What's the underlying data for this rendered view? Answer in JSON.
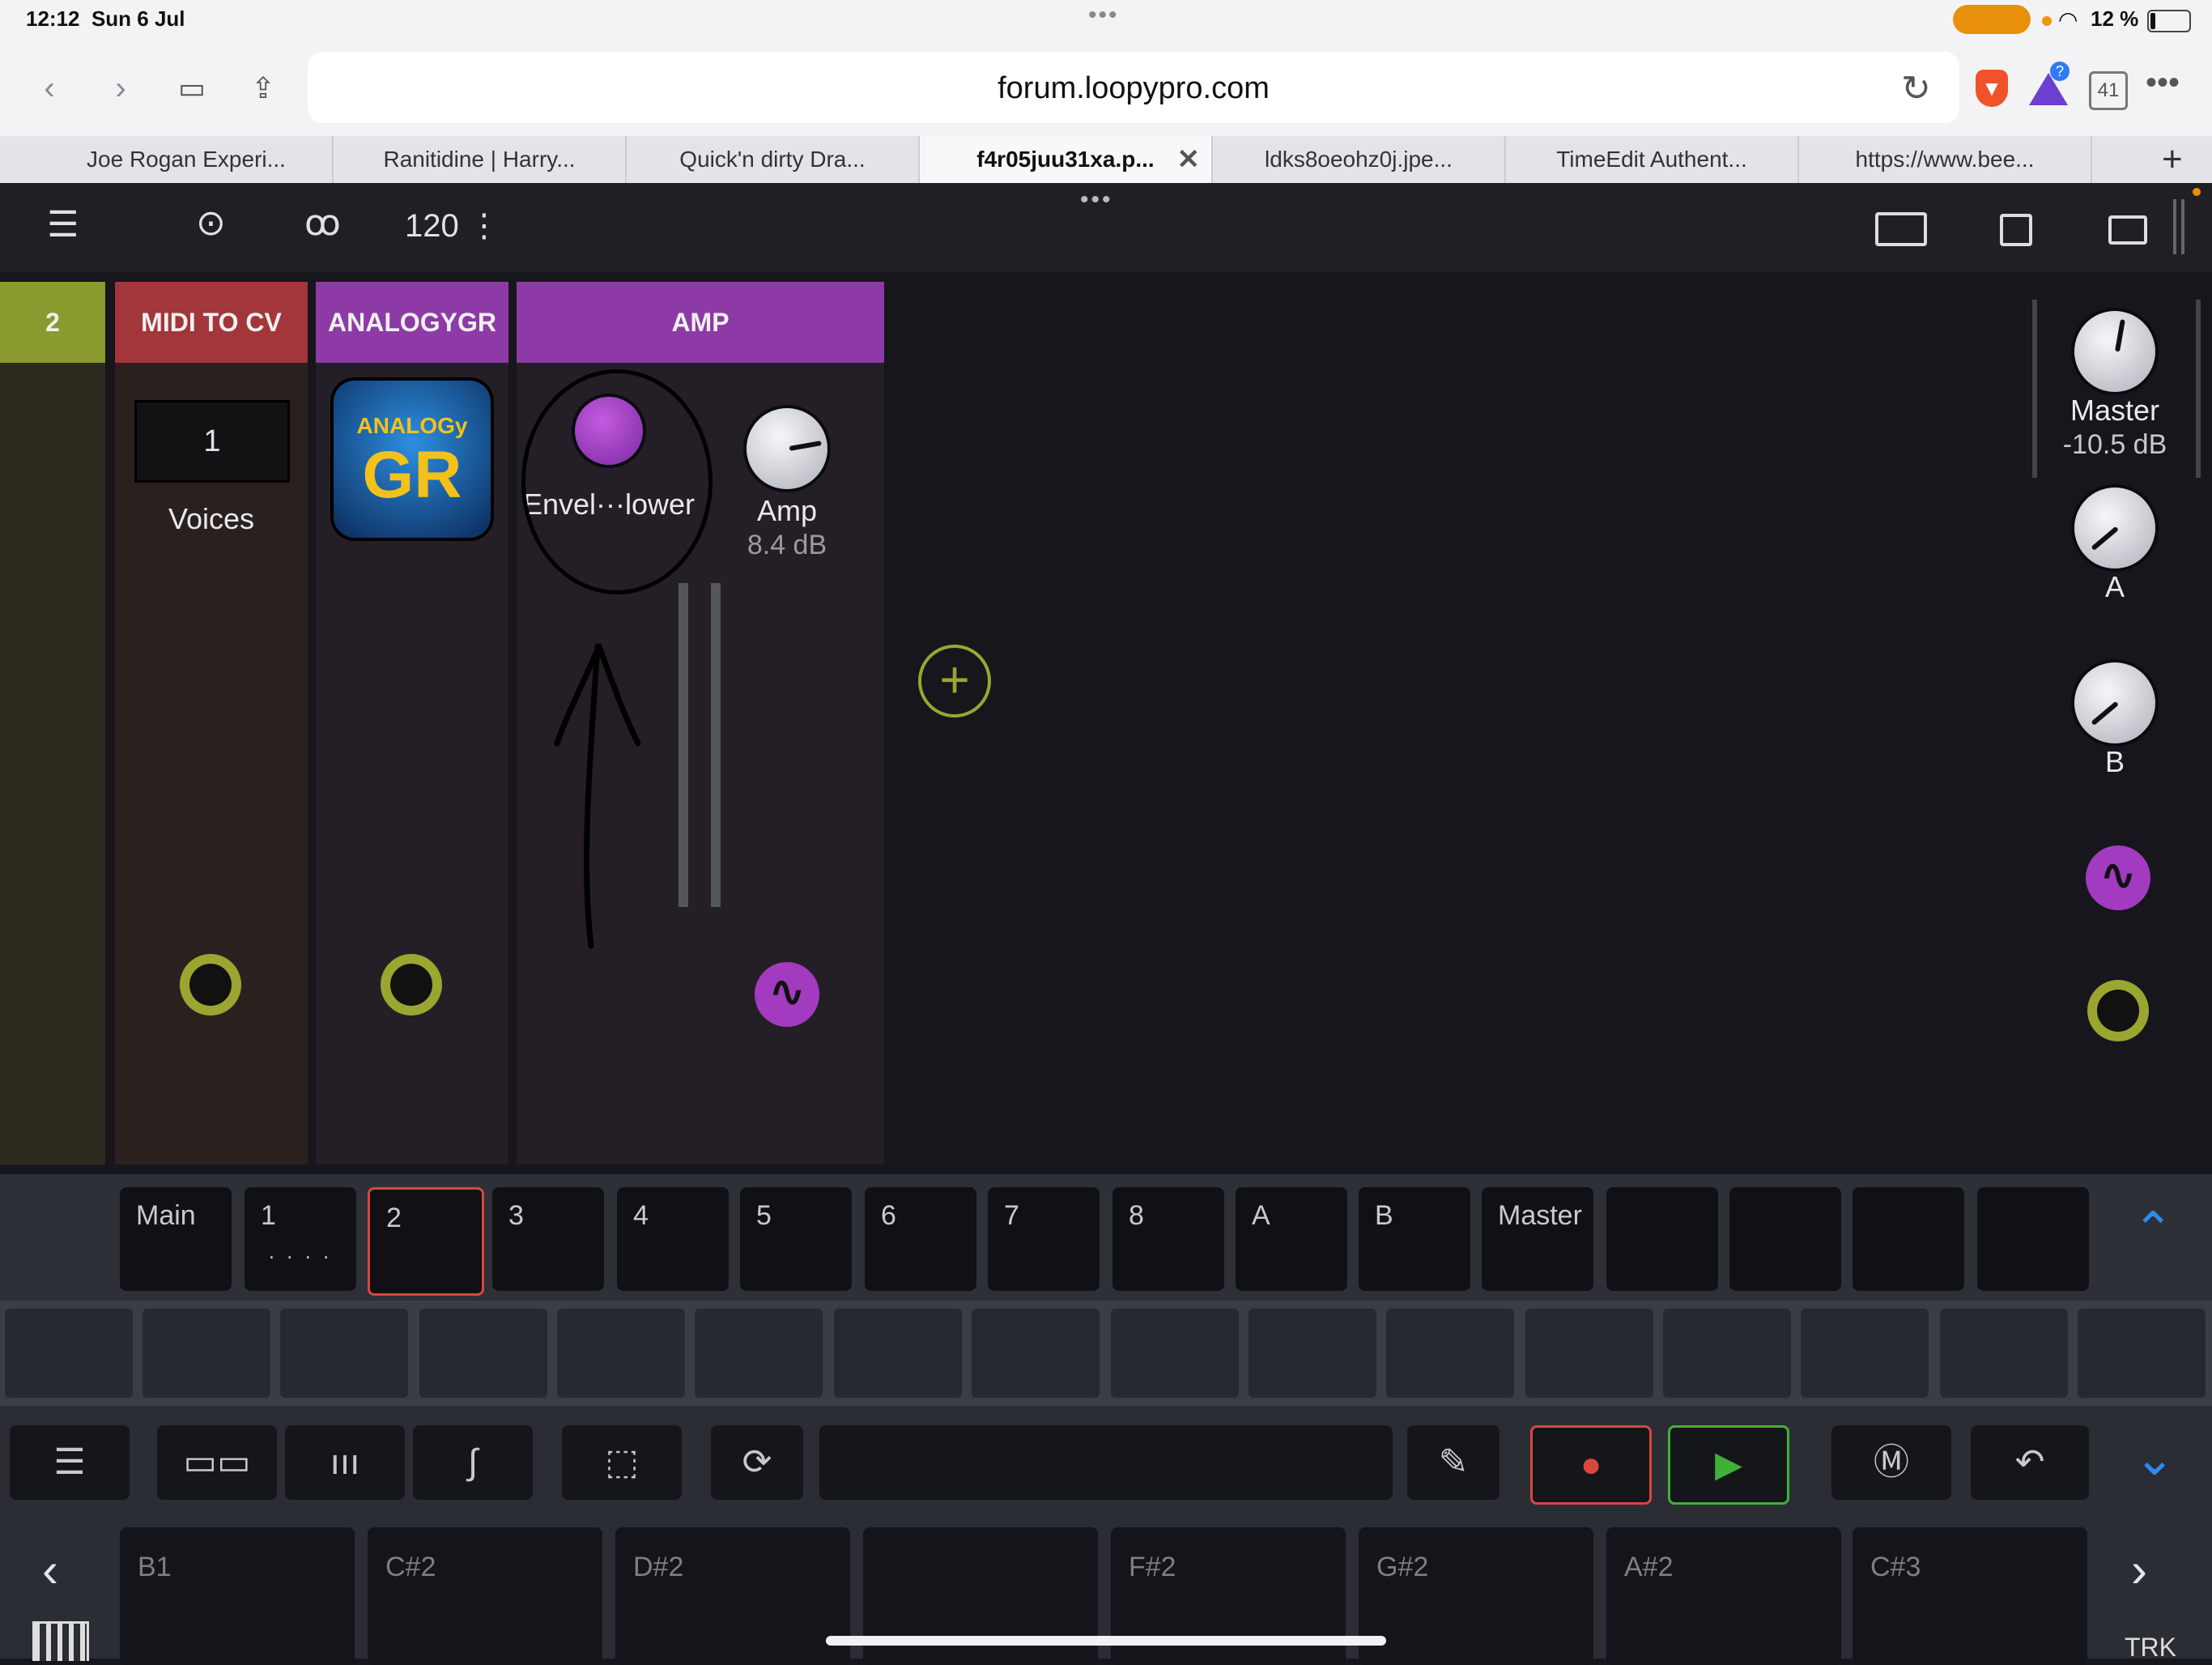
{
  "status": {
    "time": "12:12",
    "date": "Sun 6 Jul",
    "battery": "12 %"
  },
  "browser": {
    "url": "forum.loopypro.com",
    "tab_count": "41",
    "tabs": [
      {
        "label": "Joe Rogan Experi..."
      },
      {
        "label": "Ranitidine | Harry..."
      },
      {
        "label": "Quick'n dirty Dra..."
      },
      {
        "label": "f4r05juu31xa.p...",
        "active": true
      },
      {
        "label": "ldks8oeohz0j.jpe..."
      },
      {
        "label": "TimeEdit Authent..."
      },
      {
        "label": "https://www.bee..."
      }
    ]
  },
  "app": {
    "bpm": "120",
    "strips": [
      {
        "header": "2",
        "color": "#8a9a2e"
      },
      {
        "header": "MIDI TO CV",
        "color": "#a3363a",
        "voices_value": "1",
        "voices_label": "Voices"
      },
      {
        "header": "ANALOGYGR",
        "color": "#8e3aa6",
        "logo_top": "ANALOGy",
        "logo_main": "GR"
      },
      {
        "header": "AMP",
        "color": "#8e3aa6",
        "env_label": "Envel···lower",
        "amp_label": "Amp",
        "amp_value": "8.4 dB"
      }
    ],
    "master": {
      "label": "Master",
      "value": "-10.5 dB",
      "a_label": "A",
      "b_label": "B"
    },
    "banks": [
      "Main",
      "1",
      "2",
      "3",
      "4",
      "5",
      "6",
      "7",
      "8",
      "A",
      "B",
      "Master",
      "",
      "",
      "",
      ""
    ],
    "bank_sub_1": ". . . .",
    "pads": [
      "B1",
      "C#2",
      "D#2",
      "",
      "F#2",
      "G#2",
      "A#2",
      "C#3"
    ],
    "trk_label": "TRK"
  },
  "colors": {
    "accent_green": "#9aa630",
    "accent_purple": "#a23bbf",
    "record_red": "#d9463e",
    "play_green": "#3fb03a",
    "system_blue": "#2f8bf0"
  }
}
